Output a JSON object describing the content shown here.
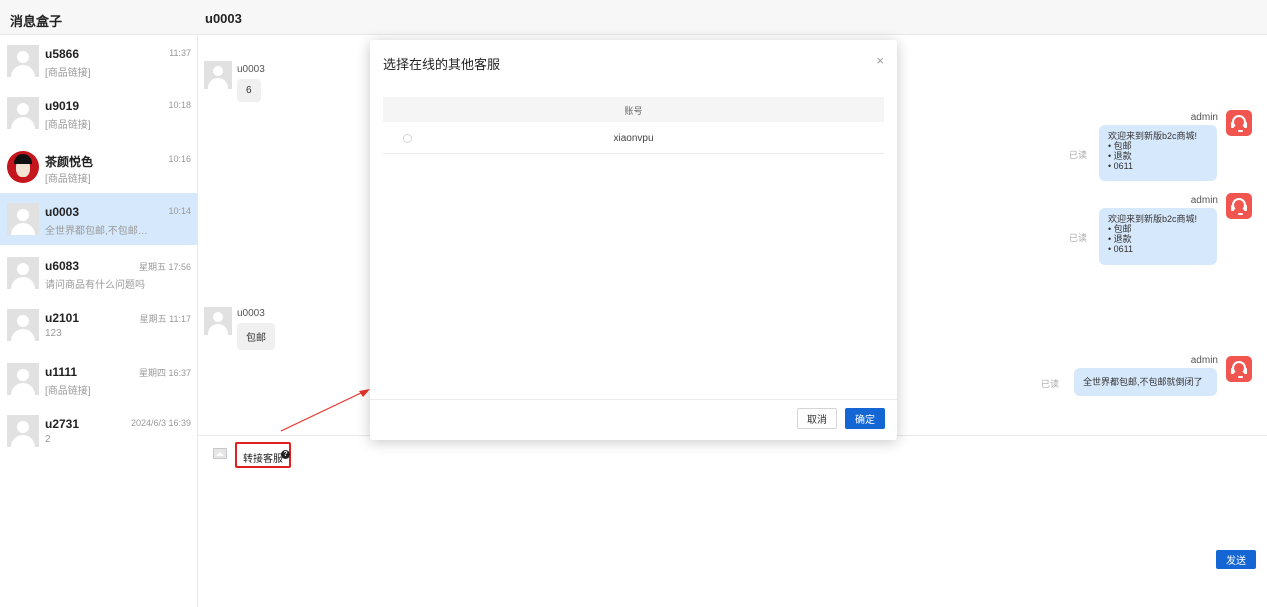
{
  "header": {
    "box_title": "消息盒子",
    "chat_title": "u0003"
  },
  "sidebar": {
    "conversations": [
      {
        "name": "u5866",
        "time": "11:37",
        "preview": "[商品链接]",
        "active": false
      },
      {
        "name": "u9019",
        "time": "10:18",
        "preview": "[商品链接]",
        "active": false
      },
      {
        "name": "茶颜悦色",
        "time": "10:16",
        "preview": "[商品链接]",
        "active": false
      },
      {
        "name": "u0003",
        "time": "10:14",
        "preview": "全世界都包邮,不包邮就倒...",
        "active": true
      },
      {
        "name": "u6083",
        "time": "星期五 17:56",
        "preview": "请问商品有什么问题吗",
        "active": false
      },
      {
        "name": "u2101",
        "time": "星期五 11:17",
        "preview": "123",
        "active": false
      },
      {
        "name": "u1111",
        "time": "星期四 16:37",
        "preview": "[商品链接]",
        "active": false
      },
      {
        "name": "u2731",
        "time": "2024/6/3 16:39",
        "preview": "2",
        "active": false
      }
    ]
  },
  "chat": {
    "messages": [
      {
        "side": "left",
        "sender": "u0003",
        "text": "6"
      },
      {
        "side": "right",
        "sender": "admin",
        "read": "已读",
        "text": "欢迎来到新版b2c商城!",
        "bullets": [
          "• 包邮",
          "• 退款",
          "• 0611"
        ]
      },
      {
        "side": "right",
        "sender": "admin",
        "read": "已读",
        "text": "欢迎来到新版b2c商城!",
        "bullets": [
          "• 包邮",
          "• 退款",
          "• 0611"
        ]
      },
      {
        "side": "left",
        "sender": "u0003",
        "text": "包邮"
      },
      {
        "side": "right",
        "sender": "admin",
        "read": "已读",
        "text": "全世界都包邮,不包邮就倒闭了"
      }
    ]
  },
  "input_area": {
    "transfer_label": "转接客服",
    "help_glyph": "?",
    "send_label": "发送"
  },
  "modal": {
    "title": "选择在线的其他客服",
    "close_glyph": "×",
    "column_header": "账号",
    "rows": [
      {
        "account": "xiaonvpu"
      }
    ],
    "cancel_label": "取消",
    "ok_label": "确定"
  },
  "colors": {
    "accent": "#1466d4",
    "active_row": "#d6e8fb",
    "agent_icon": "#f0554f",
    "highlight_border": "#e02020"
  }
}
